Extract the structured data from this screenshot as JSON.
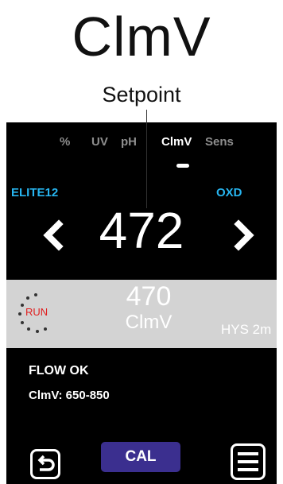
{
  "header": {
    "title": "ClmV",
    "callout": "Setpoint"
  },
  "tabs": [
    {
      "label": "%"
    },
    {
      "label": "UV"
    },
    {
      "label": "pH"
    },
    {
      "label": "ClmV",
      "active": true
    },
    {
      "label": "Sens"
    }
  ],
  "probes": {
    "left": "ELITE12",
    "right": "OXD"
  },
  "setpoint": {
    "value": "472"
  },
  "status": {
    "run_label": "RUN",
    "reading_value": "470",
    "reading_unit": "ClmV",
    "hys_label": "HYS 2m"
  },
  "info": {
    "flow": "FLOW OK",
    "range": "ClmV: 650-850"
  },
  "footer": {
    "cal_label": "CAL"
  },
  "colors": {
    "accent_blue": "#27b5f0",
    "cal_button": "#3b2f8f",
    "run_red": "#e01f1f",
    "screen_bg": "#000000",
    "status_band": "#d3d3d3"
  }
}
